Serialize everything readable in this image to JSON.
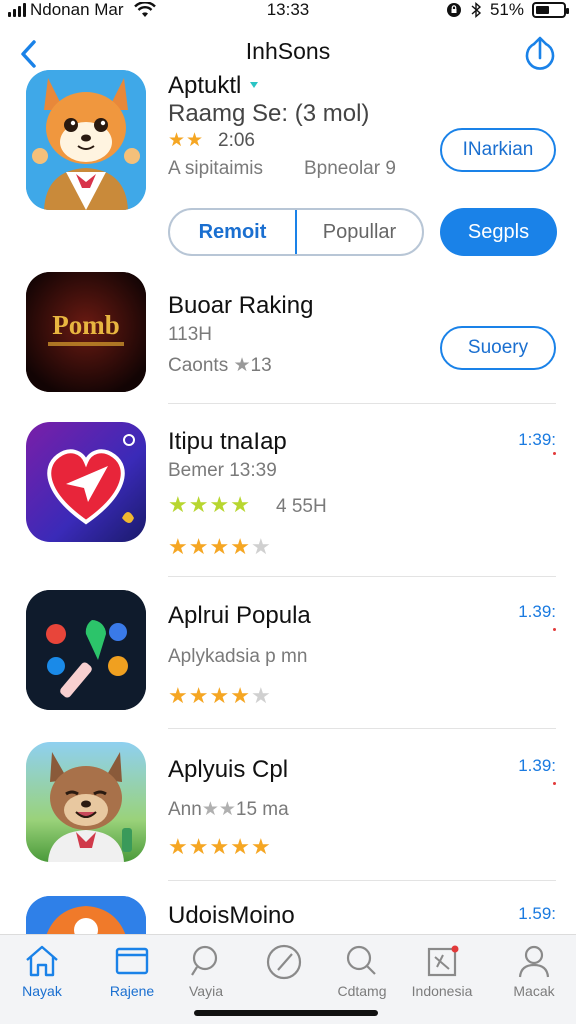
{
  "status_bar": {
    "carrier": "Ndonan Mar",
    "time": "13:33",
    "battery": "51%",
    "battery_level": 0.51
  },
  "nav": {
    "title": "InhSons"
  },
  "header_app": {
    "name": "Aptuktl",
    "subtitle": "Raamg Se: (3 mol)",
    "rating_text": "2:06",
    "stars": 2,
    "info_left": "A sipitaimis",
    "info_right": "Bpneolar 9",
    "action_label": "INarkian"
  },
  "segments": [
    {
      "label": "Remoit"
    },
    {
      "label": "Popullar"
    }
  ],
  "primary_button": "Segpls",
  "apps": [
    {
      "name": "Buoar Raking",
      "line2": "113H",
      "line3": "Caonts",
      "rating": "13",
      "action_label": "Suoery"
    },
    {
      "name": "Itipu tnaIap",
      "line2": "Bemer 13:39",
      "price": "1:39:",
      "line3_text": "4 55H",
      "stars_a": 4,
      "stars_b": 4
    },
    {
      "name": "Aplrui Popula",
      "line2": "Aplykadsia p mn",
      "price": "1.39:",
      "stars": 4
    },
    {
      "name": "Aplyuis Cpl",
      "line2": "Ann",
      "line2_suffix": "15 ma",
      "price": "1.39:",
      "stars": 5
    },
    {
      "name": "UdoisMoino",
      "price": "1.59:"
    }
  ],
  "tabs": [
    {
      "label": "Nayak",
      "icon": "home-icon"
    },
    {
      "label": "Rajene",
      "icon": "browser-icon"
    },
    {
      "label": "Vayia",
      "icon": "search-icon"
    },
    {
      "label": "",
      "icon": "compass-icon"
    },
    {
      "label": "Cdtamg",
      "icon": "search-icon"
    },
    {
      "label": "Indonesia",
      "icon": "puzzle-icon"
    },
    {
      "label": "Macak",
      "icon": "person-icon"
    }
  ],
  "colors": {
    "accent": "#1a82e8",
    "star": "#f5a623",
    "text_secondary": "#7a7a7a"
  }
}
